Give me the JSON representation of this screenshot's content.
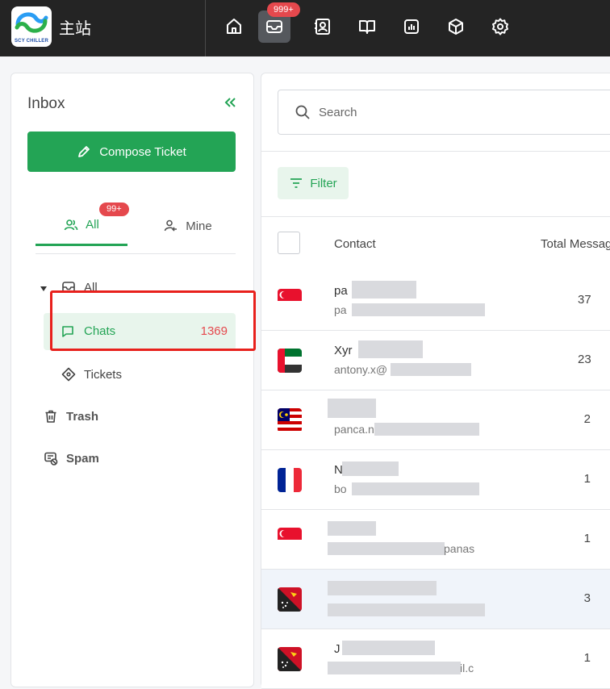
{
  "topbar": {
    "logo_text": "SCY CHILLER",
    "site_name": "主站",
    "inbox_badge": "999+",
    "nav": [
      "home-icon",
      "inbox-icon",
      "contacts-icon",
      "book-icon",
      "reports-icon",
      "package-icon",
      "settings-icon"
    ]
  },
  "sidebar": {
    "title": "Inbox",
    "compose_label": "Compose Ticket",
    "tabs": [
      {
        "label": "All",
        "badge": "99+"
      },
      {
        "label": "Mine"
      }
    ],
    "tree": {
      "all_label": "All",
      "chats_label": "Chats",
      "chats_count": "1369",
      "tickets_label": "Tickets",
      "trash_label": "Trash",
      "spam_label": "Spam"
    }
  },
  "main": {
    "search_placeholder": "Search",
    "filter_label": "Filter",
    "columns": {
      "contact": "Contact",
      "total": "Total Messag"
    },
    "rows": [
      {
        "flag": "singapore",
        "name": "pa",
        "email": "pa",
        "count": "37"
      },
      {
        "flag": "uae",
        "name": "Xyr",
        "email": "antony.x@",
        "count": "23"
      },
      {
        "flag": "malaysia",
        "name": "",
        "email": "panca.n",
        "count": "2"
      },
      {
        "flag": "france",
        "name": "N",
        "email": "bo",
        "count": "1"
      },
      {
        "flag": "singapore",
        "name": "",
        "email": "panas",
        "count": "1"
      },
      {
        "flag": "papua-new-guinea",
        "name": "",
        "email": "",
        "count": "3"
      },
      {
        "flag": "papua-new-guinea",
        "name": "J",
        "email": "il.c",
        "count": "1"
      }
    ]
  },
  "colors": {
    "accent": "#23a455",
    "badge": "#e5484d",
    "topbar": "#242424",
    "highlight": "#e8201c"
  }
}
